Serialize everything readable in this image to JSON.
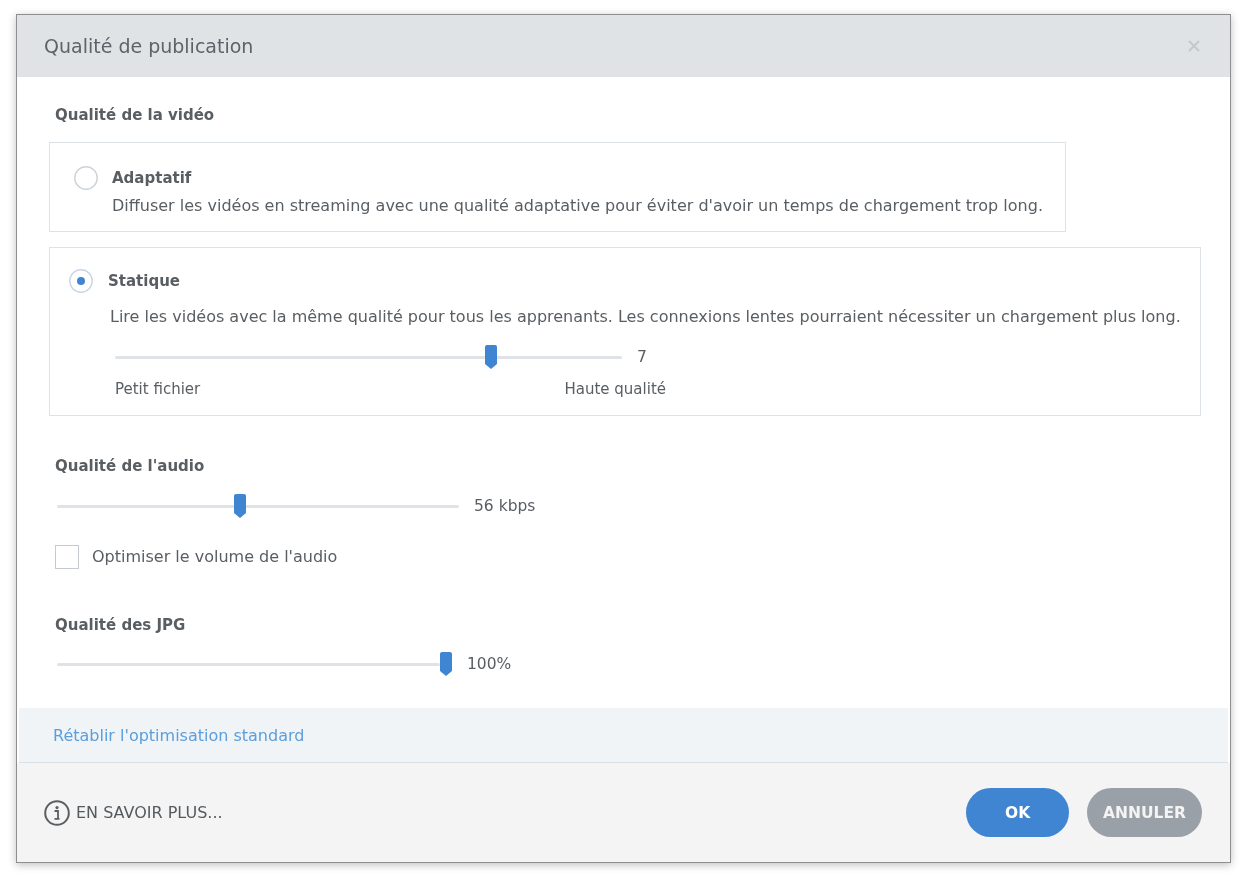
{
  "window": {
    "title": "Qualité de publication"
  },
  "video_quality": {
    "heading": "Qualité de la vidéo",
    "options": [
      {
        "label": "Adaptatif",
        "description": "Diffuser les vidéos en streaming avec une qualité adaptative pour éviter d'avoir un temps de chargement trop long.",
        "selected": false
      },
      {
        "label": "Statique",
        "description": "Lire les vidéos avec la même qualité pour tous les apprenants. Les connexions lentes pourraient nécessiter un chargement plus long.",
        "selected": true,
        "slider": {
          "level": 0.73,
          "reading": "7",
          "min_label": "Petit fichier",
          "max_label": "Haute qualité"
        }
      }
    ]
  },
  "audio_quality": {
    "heading": "Qualité de l'audio",
    "slider": {
      "level": 0.44,
      "reading": "56 kbps"
    },
    "checkbox": {
      "label": "Optimiser le volume de l'audio",
      "checked": false
    }
  },
  "jpg_quality": {
    "heading": "Qualité des JPG",
    "slider": {
      "level": 1,
      "reading": "100%"
    }
  },
  "reset_link": "Rétablir l'optimisation standard",
  "footer": {
    "learn_more": "EN SAVOIR PLUS...",
    "buttons": [
      {
        "label": "OK",
        "kind": "primary"
      },
      {
        "label": "ANNULER",
        "kind": "secondary"
      }
    ]
  }
}
